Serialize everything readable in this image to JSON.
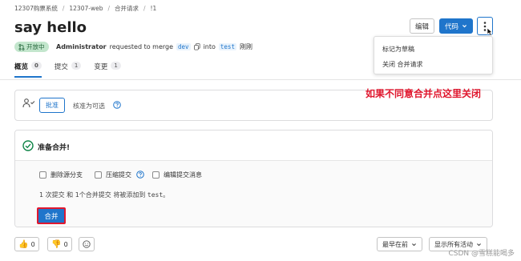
{
  "breadcrumb": [
    "12307购票系统",
    "12307-web",
    "合并请求",
    "!1"
  ],
  "title": "say hello",
  "header_buttons": {
    "edit": "编辑",
    "code": "代码"
  },
  "dropdown": {
    "items": [
      "标记为草稿",
      "关闭 合并请求"
    ]
  },
  "status": {
    "badge": "开放中"
  },
  "meta": {
    "author": "Administrator",
    "requested_to_merge": "requested to merge",
    "source_branch": "dev",
    "into": "into",
    "target_branch": "test",
    "time": "刚刚"
  },
  "tabs": [
    {
      "label": "概览",
      "count": "0"
    },
    {
      "label": "提交",
      "count": "1"
    },
    {
      "label": "变更",
      "count": "1"
    }
  ],
  "annotation": "如果不同意合并点这里关闭",
  "approval": {
    "approve_label": "批准",
    "optional_text": "核准为可选"
  },
  "merge": {
    "ready_title": "准备合并!",
    "options": [
      "删除源分支",
      "压缩提交",
      "编辑提交消息"
    ],
    "summary_prefix": "1 次提交 和 1个合并提交 将被添加到 ",
    "summary_branch": "test",
    "summary_suffix": "。",
    "merge_button": "合并"
  },
  "reactions": {
    "thumbs_up": "0",
    "thumbs_down": "0"
  },
  "sort": {
    "order": "最早在前",
    "filter": "显示所有活动"
  },
  "watermark": "CSDN @雪糕能喝多",
  "colors": {
    "accent": "#1f75cb",
    "success": "#108548",
    "annotation": "#e0172e"
  }
}
